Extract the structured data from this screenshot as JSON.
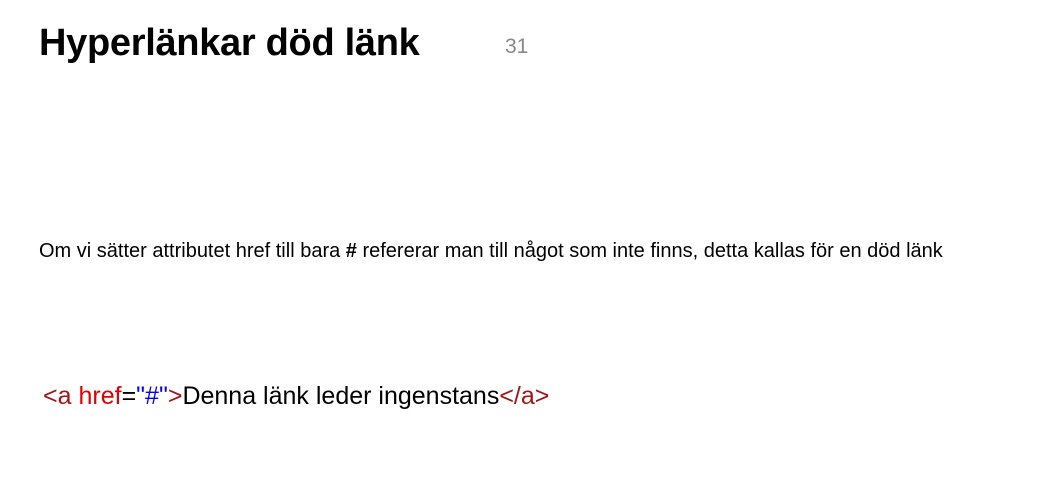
{
  "slide": {
    "title": "Hyperlänkar död länk",
    "number": "31"
  },
  "body": {
    "before_hash": "Om vi sätter attributet href till bara ",
    "hash": "#",
    "after_hash": " refererar man till något som inte finns, detta kallas för en död länk"
  },
  "code": {
    "open_tag": "<a",
    "space": " ",
    "attr_name": "href",
    "equals": "=",
    "attr_value": "\"#\"",
    "close_bracket": ">",
    "link_text": "Denna länk leder ingenstans",
    "end_tag": "</a>"
  },
  "colors": {
    "tag": "#a31515",
    "attribute": "#e50000",
    "value": "#0000ff",
    "slide_number": "#888888"
  }
}
